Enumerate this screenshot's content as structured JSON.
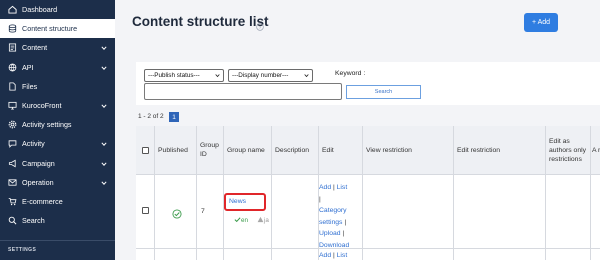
{
  "sidebar": {
    "items": [
      {
        "label": "Dashboard",
        "icon": "home-icon",
        "chevron": false,
        "active": false
      },
      {
        "label": "Content structure",
        "icon": "database-icon",
        "chevron": false,
        "active": true
      },
      {
        "label": "Content",
        "icon": "document-icon",
        "chevron": true,
        "active": false
      },
      {
        "label": "API",
        "icon": "globe-icon",
        "chevron": true,
        "active": false
      },
      {
        "label": "Files",
        "icon": "file-icon",
        "chevron": false,
        "active": false
      },
      {
        "label": "KurocoFront",
        "icon": "screen-icon",
        "chevron": true,
        "active": false
      },
      {
        "label": "Activity settings",
        "icon": "gear-icon",
        "chevron": false,
        "active": false
      },
      {
        "label": "Activity",
        "icon": "bubble-icon",
        "chevron": true,
        "active": false
      },
      {
        "label": "Campaign",
        "icon": "megaphone-icon",
        "chevron": true,
        "active": false
      },
      {
        "label": "Operation",
        "icon": "envelope-icon",
        "chevron": true,
        "active": false
      },
      {
        "label": "E-commerce",
        "icon": "cart-icon",
        "chevron": false,
        "active": false
      },
      {
        "label": "Search",
        "icon": "search-icon",
        "chevron": false,
        "active": false
      }
    ],
    "section_label": "SETTINGS"
  },
  "header": {
    "title": "Content structure list",
    "add_label": "+ Add"
  },
  "filters": {
    "publish_status": "---Publish status---",
    "display_number": "---Display number---",
    "keyword_label": "Keyword :",
    "keyword_value": "",
    "search_label": "Search"
  },
  "pagination": {
    "count": "1 - 2 of 2",
    "current_page": "1"
  },
  "table": {
    "headers": {
      "published": "Published",
      "group_id": "Group ID",
      "group_name": "Group name",
      "description": "Description",
      "edit": "Edit",
      "view_restriction": "View restriction",
      "edit_restriction": "Edit restriction",
      "authors_only": "Edit as authors only restrictions",
      "next_col": "A r"
    },
    "rows": [
      {
        "group_id": "7",
        "group_name": "News",
        "lang_en": "en",
        "lang_ja": "ja",
        "edit_links": [
          "Add",
          "List",
          "Category settings",
          "Upload",
          "Download"
        ]
      },
      {
        "edit_links": [
          "Add",
          "List"
        ]
      }
    ]
  },
  "colors": {
    "sidebar_bg": "#1c2e4a",
    "accent": "#2f7de1",
    "highlight_box": "#e0262a",
    "published_green": "#3a9a4a"
  }
}
